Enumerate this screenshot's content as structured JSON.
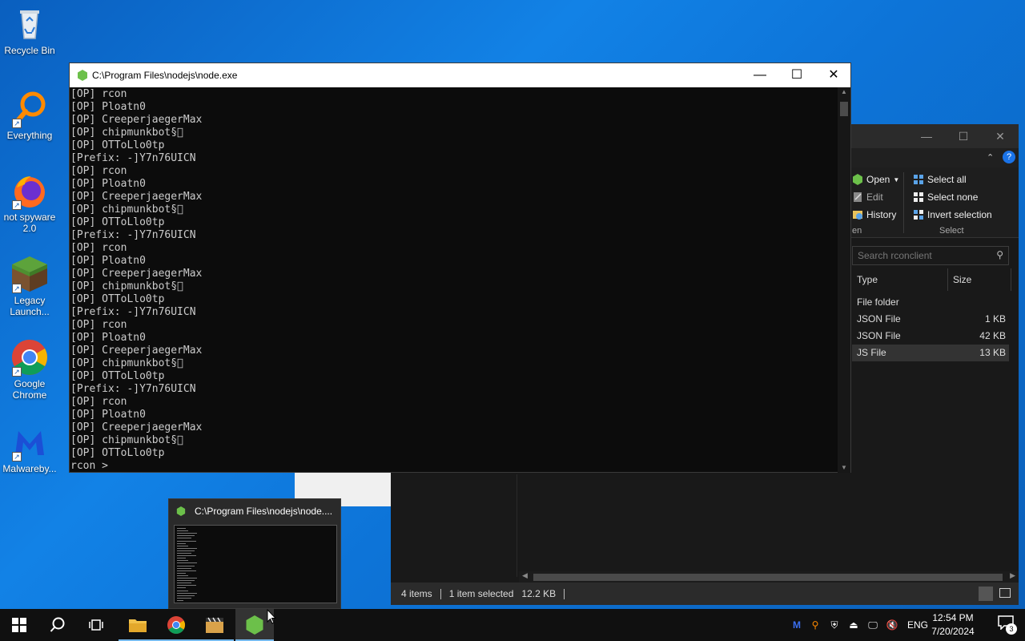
{
  "desktop": {
    "icons": [
      {
        "label": "Recycle Bin",
        "icon": "recycle-bin-icon"
      },
      {
        "label": "Everything",
        "icon": "search-magnifier-icon"
      },
      {
        "label": "not spyware 2.0",
        "icon": "firefox-icon"
      },
      {
        "label": "Legacy Launch...",
        "icon": "minecraft-grass-block-icon"
      },
      {
        "label": "Google Chrome",
        "icon": "chrome-icon"
      },
      {
        "label": "Malwareby...",
        "icon": "malwarebytes-icon"
      }
    ]
  },
  "console": {
    "title": "C:\\Program Files\\nodejs\\node.exe",
    "lines": [
      "[OP] rcon",
      "[OP] Ploatn0",
      "[OP] CreeperjaegerMax",
      "[OP] chipmunkbot§\u0000",
      "[OP] OTToLlo0tp",
      "[Prefix: -]Y7n76UICN",
      "[OP] rcon",
      "[OP] Ploatn0",
      "[OP] CreeperjaegerMax",
      "[OP] chipmunkbot§\u0000",
      "[OP] OTToLlo0tp",
      "[Prefix: -]Y7n76UICN",
      "[OP] rcon",
      "[OP] Ploatn0",
      "[OP] CreeperjaegerMax",
      "[OP] chipmunkbot§\u0000",
      "[OP] OTToLlo0tp",
      "[Prefix: -]Y7n76UICN",
      "[OP] rcon",
      "[OP] Ploatn0",
      "[OP] CreeperjaegerMax",
      "[OP] chipmunkbot§\u0000",
      "[OP] OTToLlo0tp",
      "[Prefix: -]Y7n76UICN",
      "[OP] rcon",
      "[OP] Ploatn0",
      "[OP] CreeperjaegerMax",
      "[OP] chipmunkbot§\u0000",
      "[OP] OTToLlo0tp",
      "rcon > "
    ]
  },
  "explorer": {
    "ribbon": {
      "open": "Open",
      "edit": "Edit",
      "history": "History",
      "open_group": "en",
      "select_all": "Select all",
      "select_none": "Select none",
      "invert_selection": "Invert selection",
      "select_group": "Select"
    },
    "search_placeholder": "Search rconclient",
    "columns": {
      "type": "Type",
      "size": "Size"
    },
    "rows": [
      {
        "type": "File folder",
        "size": ""
      },
      {
        "type": "JSON File",
        "size": "1 KB"
      },
      {
        "type": "JSON File",
        "size": "42 KB"
      },
      {
        "type": "JS File",
        "size": "13 KB"
      }
    ],
    "status": {
      "items": "4 items",
      "selected": "1 item selected",
      "size": "12.2 KB"
    }
  },
  "thumbnail": {
    "title": "C:\\Program Files\\nodejs\\node...."
  },
  "taskbar": {
    "language": "ENG",
    "time": "12:54 PM",
    "date": "7/20/2024",
    "notification_count": "3"
  }
}
